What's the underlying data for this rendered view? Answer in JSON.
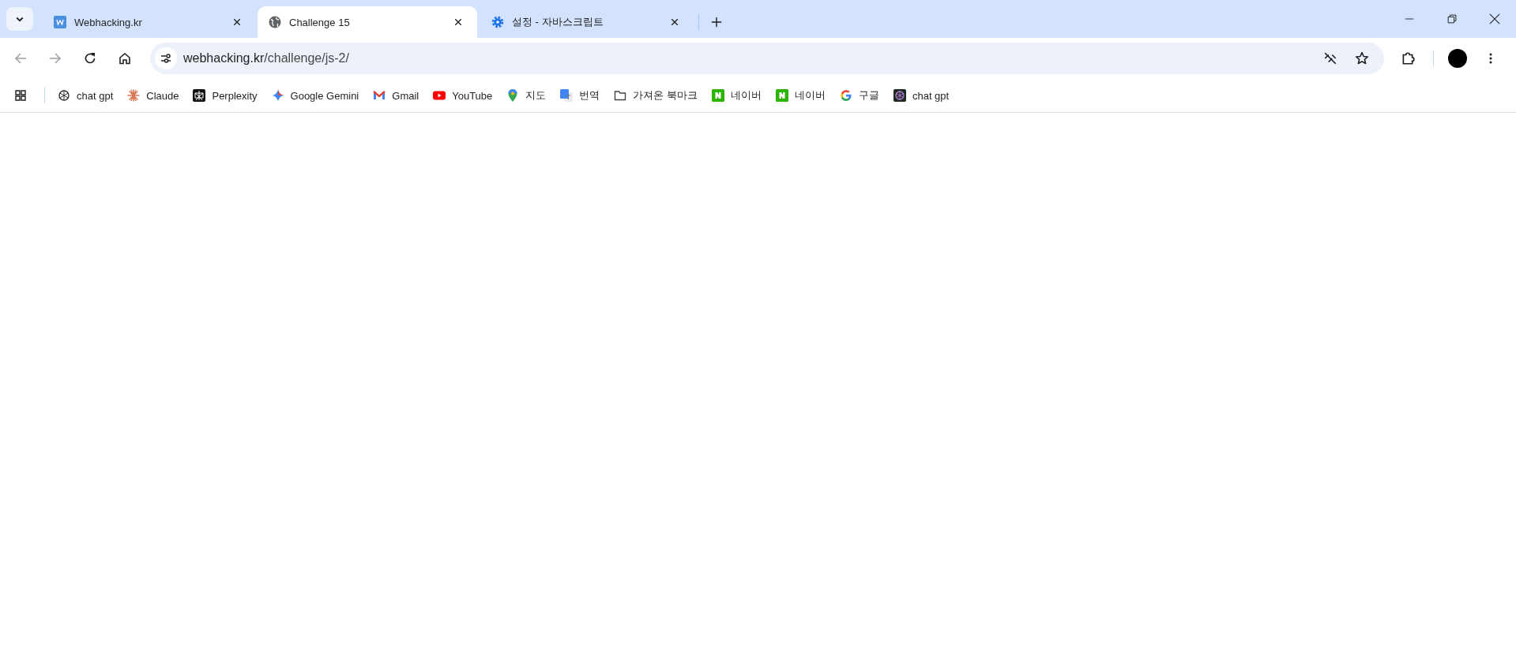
{
  "tabs": [
    {
      "title": "Webhacking.kr",
      "kind": "w-logo",
      "selected": false
    },
    {
      "title": "Challenge 15",
      "kind": "globe",
      "selected": true
    },
    {
      "title": "설정 - 자바스크립트",
      "kind": "gear",
      "selected": false
    }
  ],
  "address_bar": {
    "host": "webhacking.kr",
    "path": "/challenge/js-2/"
  },
  "bookmarks": [
    {
      "label": "chat gpt",
      "kind": "openai"
    },
    {
      "label": "Claude",
      "kind": "claude"
    },
    {
      "label": "Perplexity",
      "kind": "perplexity"
    },
    {
      "label": "Google Gemini",
      "kind": "gemini"
    },
    {
      "label": "Gmail",
      "kind": "gmail"
    },
    {
      "label": "YouTube",
      "kind": "youtube"
    },
    {
      "label": "지도",
      "kind": "maps"
    },
    {
      "label": "번역",
      "kind": "translate"
    },
    {
      "label": "가져온 북마크",
      "kind": "folder"
    },
    {
      "label": "네이버",
      "kind": "naver"
    },
    {
      "label": "네이버",
      "kind": "naver"
    },
    {
      "label": "구글",
      "kind": "google"
    },
    {
      "label": "chat gpt",
      "kind": "openai-dark"
    }
  ]
}
